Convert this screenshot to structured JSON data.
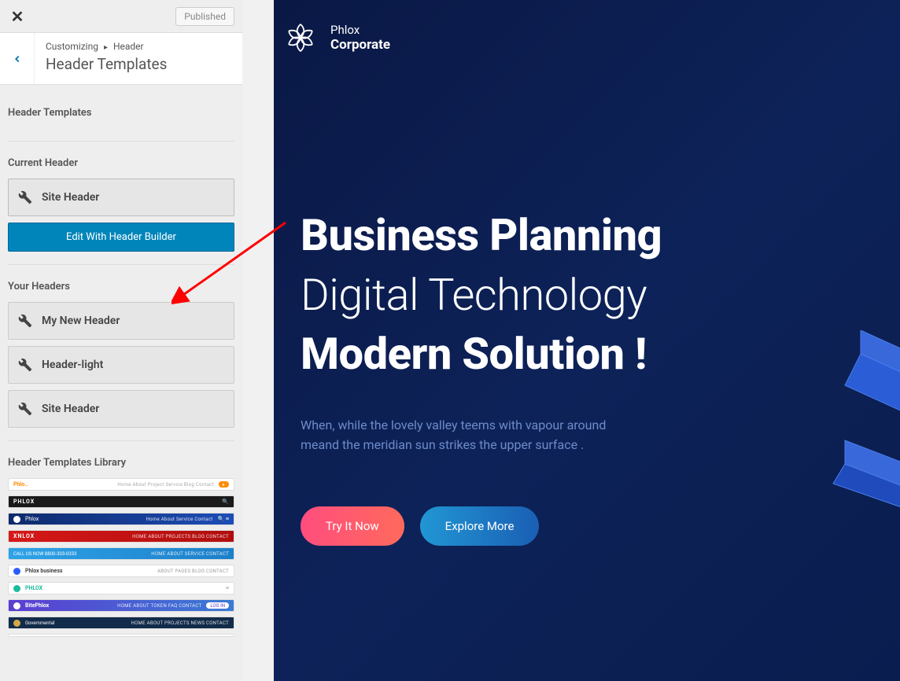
{
  "panel": {
    "published_label": "Published",
    "breadcrumb": {
      "root": "Customizing",
      "parent": "Header",
      "title": "Header Templates"
    },
    "section_templates": "Header Templates",
    "section_current": "Current Header",
    "current_header": "Site Header",
    "edit_button": "Edit With Header Builder",
    "section_your": "Your Headers",
    "your_headers": [
      "My New Header",
      "Header-light",
      "Site Header"
    ],
    "section_library": "Header Templates Library"
  },
  "preview": {
    "brand_line1": "Phlox",
    "brand_line2": "Corporate",
    "headline1": "Business Planning",
    "headline2": "Digital Technology",
    "headline3": "Modern Solution !",
    "subtext": "When, while the lovely valley teems with vapour around meand the meridian sun strikes the upper surface .",
    "cta_primary": "Try It Now",
    "cta_secondary": "Explore More"
  }
}
